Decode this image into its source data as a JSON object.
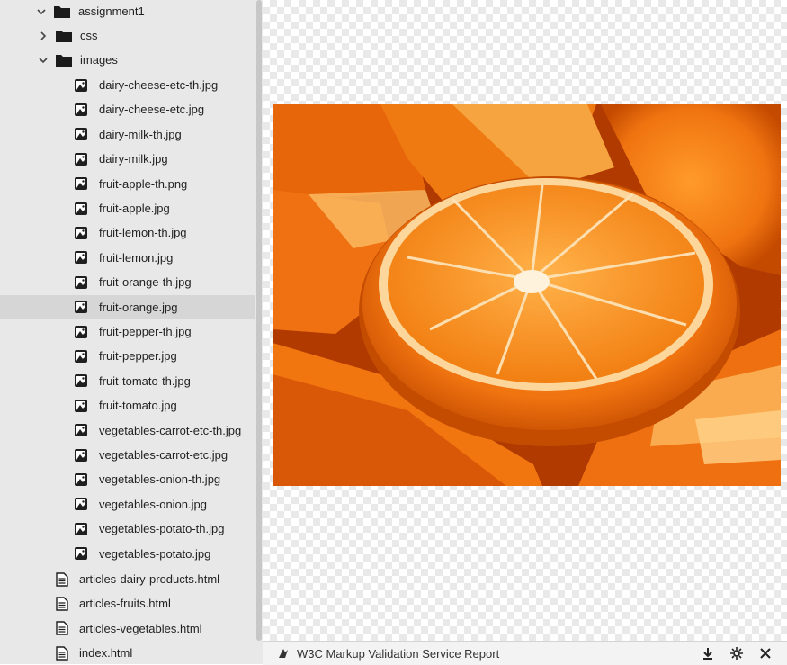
{
  "file_tree": {
    "root": {
      "label": "assignment1"
    },
    "folders": [
      {
        "label": "css",
        "expanded": false
      },
      {
        "label": "images",
        "expanded": true
      }
    ],
    "images": [
      "dairy-cheese-etc-th.jpg",
      "dairy-cheese-etc.jpg",
      "dairy-milk-th.jpg",
      "dairy-milk.jpg",
      "fruit-apple-th.png",
      "fruit-apple.jpg",
      "fruit-lemon-th.jpg",
      "fruit-lemon.jpg",
      "fruit-orange-th.jpg",
      "fruit-orange.jpg",
      "fruit-pepper-th.jpg",
      "fruit-pepper.jpg",
      "fruit-tomato-th.jpg",
      "fruit-tomato.jpg",
      "vegetables-carrot-etc-th.jpg",
      "vegetables-carrot-etc.jpg",
      "vegetables-onion-th.jpg",
      "vegetables-onion.jpg",
      "vegetables-potato-th.jpg",
      "vegetables-potato.jpg"
    ],
    "selected_image": "fruit-orange.jpg",
    "files": [
      "articles-dairy-products.html",
      "articles-fruits.html",
      "articles-vegetables.html",
      "index.html"
    ]
  },
  "bottom_panel": {
    "title": "W3C Markup Validation Service Report",
    "icons": [
      "download-icon",
      "settings-icon",
      "close-icon"
    ]
  },
  "preview": {
    "image_name": "fruit-orange.jpg",
    "colors": {
      "orange": "#f07b12",
      "dark_orange": "#c94400",
      "pith": "#fbe0b0"
    }
  }
}
